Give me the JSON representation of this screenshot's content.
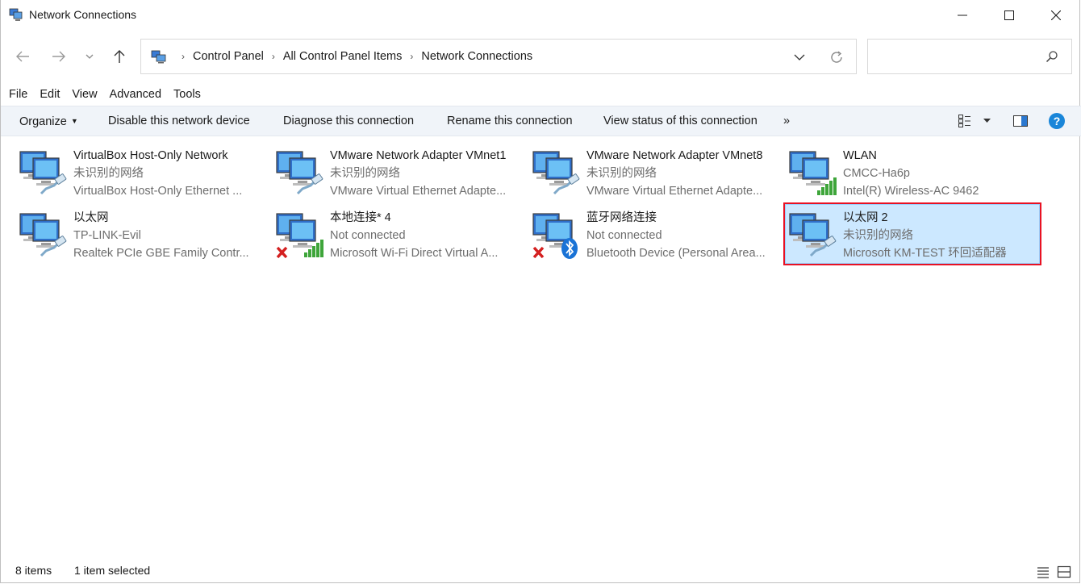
{
  "window": {
    "title": "Network Connections",
    "controls": {
      "minimize": "minimize",
      "maximize": "maximize",
      "close": "close"
    }
  },
  "nav": {
    "breadcrumb": [
      "Control Panel",
      "All Control Panel Items",
      "Network Connections"
    ],
    "search": {
      "value": "",
      "placeholder": ""
    }
  },
  "menu": [
    "File",
    "Edit",
    "View",
    "Advanced",
    "Tools"
  ],
  "commands": {
    "organize": "Organize",
    "disable": "Disable this network device",
    "diagnose": "Diagnose this connection",
    "rename": "Rename this connection",
    "view_status": "View status of this connection",
    "more": "»"
  },
  "connections": [
    {
      "name": "VirtualBox Host-Only Network",
      "status": "未识别的网络",
      "device": "VirtualBox Host-Only Ethernet ...",
      "badge": "ethernet-cable",
      "selected": false
    },
    {
      "name": "VMware Network Adapter VMnet1",
      "status": "未识别的网络",
      "device": "VMware Virtual Ethernet Adapte...",
      "badge": "ethernet-cable",
      "selected": false
    },
    {
      "name": "VMware Network Adapter VMnet8",
      "status": "未识别的网络",
      "device": "VMware Virtual Ethernet Adapte...",
      "badge": "ethernet-cable",
      "selected": false
    },
    {
      "name": "WLAN",
      "status": "CMCC-Ha6p",
      "device": "Intel(R) Wireless-AC 9462",
      "badge": "wifi-signal",
      "selected": false
    },
    {
      "name": "以太网",
      "status": "TP-LINK-Evil",
      "device": "Realtek PCIe GBE Family Contr...",
      "badge": "ethernet-cable",
      "selected": false
    },
    {
      "name": "本地连接* 4",
      "status": "Not connected",
      "device": "Microsoft Wi-Fi Direct Virtual A...",
      "badge": "wifi-signal-disconnected",
      "selected": false
    },
    {
      "name": "蓝牙网络连接",
      "status": "Not connected",
      "device": "Bluetooth Device (Personal Area...",
      "badge": "bluetooth-disconnected",
      "selected": false
    },
    {
      "name": "以太网 2",
      "status": "未识别的网络",
      "device": "Microsoft KM-TEST 环回适配器",
      "badge": "ethernet-cable",
      "selected": true
    }
  ],
  "statusbar": {
    "count": "8 items",
    "selection": "1 item selected"
  },
  "colors": {
    "accent": "#0078d4",
    "selection_bg": "#cce8ff",
    "highlight_border": "#e81123",
    "command_bar": "#f0f4f9",
    "help": "#1a86d9"
  }
}
